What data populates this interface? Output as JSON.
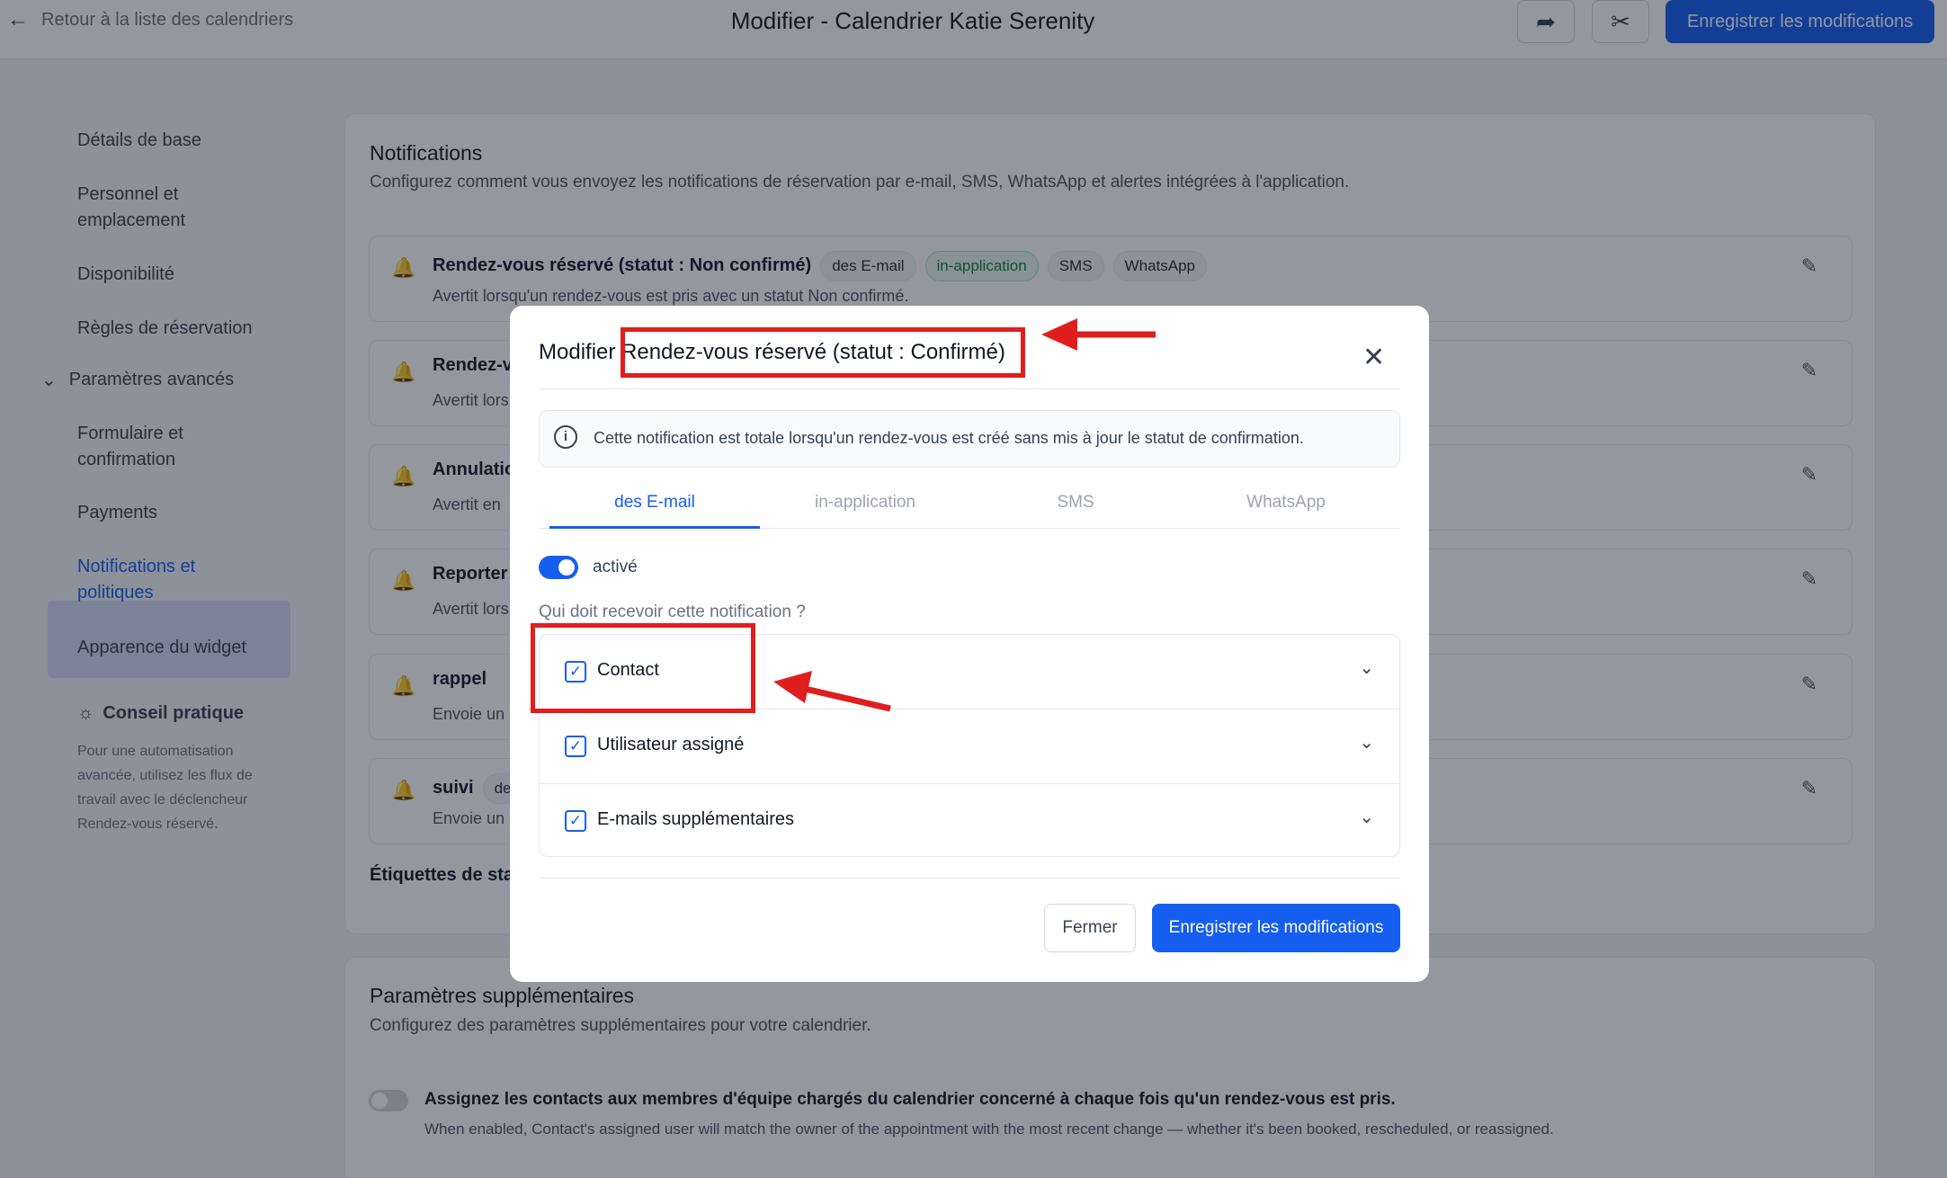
{
  "topbar": {
    "back_label": "Retour à la liste des calendriers",
    "title": "Modifier - Calendrier Katie Serenity",
    "save_label": "Enregistrer les modifications"
  },
  "sidebar": {
    "items": [
      {
        "label": "Détails de base"
      },
      {
        "label": "Personnel et emplacement"
      },
      {
        "label": "Disponibilité"
      },
      {
        "label": "Règles de réservation"
      },
      {
        "label": "Paramètres avancés"
      },
      {
        "label": "Formulaire et confirmation"
      },
      {
        "label": "Payments"
      },
      {
        "label": "Notifications et politiques"
      },
      {
        "label": "Apparence du widget"
      }
    ],
    "tip_title": "Conseil pratique",
    "tip_body": "Pour une automatisation avancée, utilisez les flux de travail avec le déclencheur Rendez-vous réservé."
  },
  "notifications": {
    "title": "Notifications",
    "subtitle": "Configurez comment vous envoyez les notifications de réservation par e-mail, SMS, WhatsApp et alertes intégrées à l'application.",
    "rows": [
      {
        "title": "Rendez-vous réservé (statut : Non confirmé)",
        "desc": "Avertit lorsqu'un rendez-vous est pris avec un statut Non confirmé.",
        "chips": [
          "des E-mail",
          "in-application",
          "SMS",
          "WhatsApp"
        ]
      },
      {
        "title": "Rendez-v",
        "desc": "Avertit lors"
      },
      {
        "title": "Annulatio",
        "desc": "Avertit en"
      },
      {
        "title": "Reporter",
        "desc": "Avertit lors"
      },
      {
        "title": "rappel",
        "desc": "Envoie un"
      },
      {
        "title": "suivi",
        "desc": "Envoie un",
        "chip": "de"
      }
    ],
    "status_labels": "Étiquettes de stat"
  },
  "extra": {
    "title": "Paramètres supplémentaires",
    "subtitle": "Configurez des paramètres supplémentaires pour votre calendrier.",
    "toggle_label": "Assignez les contacts aux membres d'équipe chargés du calendrier concerné à chaque fois qu'un rendez-vous est pris.",
    "toggle_desc": "When enabled, Contact's assigned user will match the owner of the appointment with the most recent change — whether it's been booked, rescheduled, or reassigned."
  },
  "modal": {
    "title_prefix": "Modifier",
    "title_name": "Rendez-vous réservé (statut : Confirmé)",
    "info": "Cette notification est totale lorsqu'un rendez-vous est créé sans mis à jour le statut de confirmation.",
    "tabs": [
      "des E-mail",
      "in-application",
      "SMS",
      "WhatsApp"
    ],
    "active_tab": "des E-mail",
    "enabled": true,
    "enabled_label": "activé",
    "question": "Qui doit recevoir cette notification ?",
    "recipients": [
      {
        "label": "Contact",
        "checked": true
      },
      {
        "label": "Utilisateur assigné",
        "checked": true
      },
      {
        "label": "E-mails supplémentaires",
        "checked": true
      }
    ],
    "close_label": "Fermer",
    "save_label": "Enregistrer les modifications"
  },
  "colors": {
    "accent": "#155eef",
    "annotation": "#e01e1e"
  }
}
